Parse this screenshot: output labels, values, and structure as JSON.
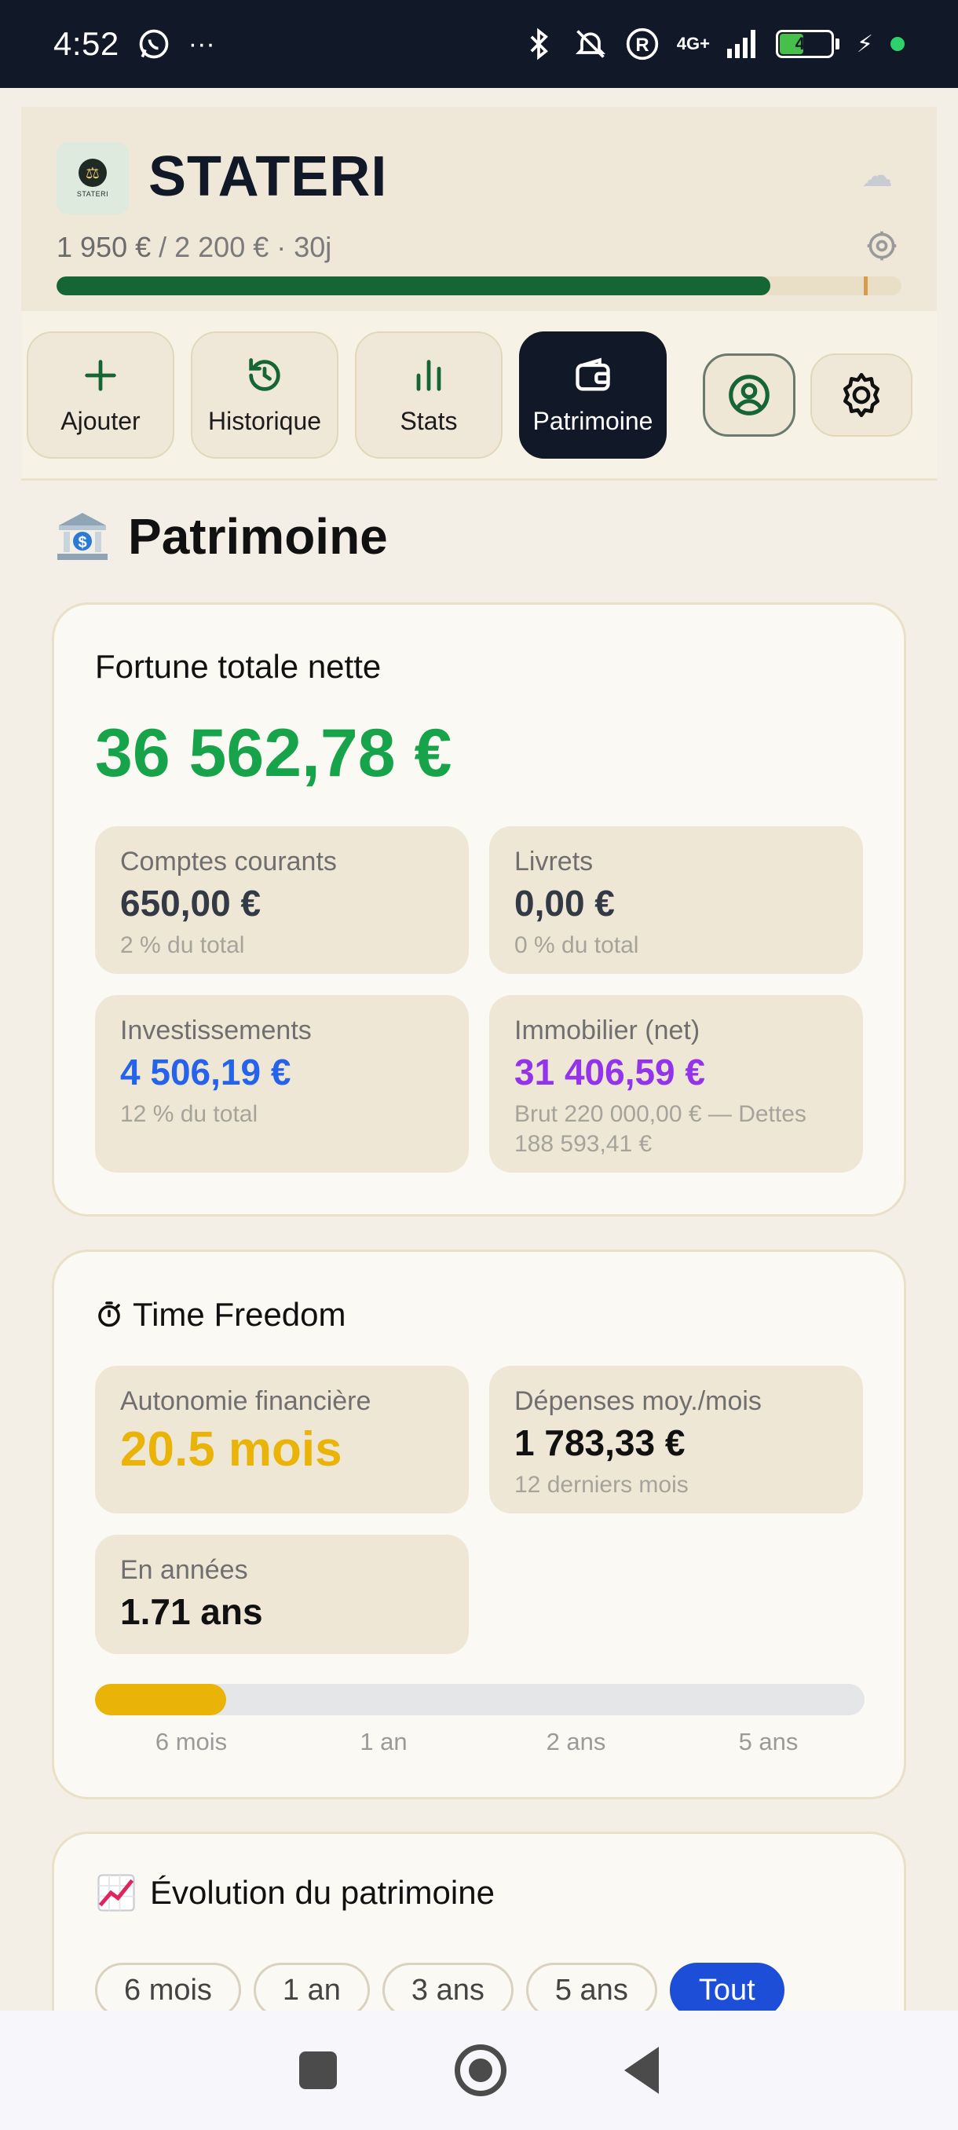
{
  "status_bar": {
    "time": "4:52",
    "network": "4G+",
    "battery_level": "47",
    "battery_fraction": 0.47,
    "more": "···"
  },
  "header": {
    "logo_text": "STATERI",
    "title": "STATERI",
    "budget_spent": "1 950 €",
    "budget_rest": " / 2 200 € · 30j",
    "budget_progress": 0.845,
    "budget_marker": 0.955
  },
  "nav": {
    "add": "Ajouter",
    "history": "Historique",
    "stats": "Stats",
    "wealth": "Patrimoine"
  },
  "page": {
    "title": "Patrimoine"
  },
  "net_worth": {
    "title": "Fortune totale nette",
    "value": "36 562,78 €",
    "tiles": {
      "current": {
        "label": "Comptes courants",
        "value": "650,00 €",
        "sub": "2 % du total"
      },
      "savings": {
        "label": "Livrets",
        "value": "0,00 €",
        "sub": "0 % du total"
      },
      "investments": {
        "label": "Investissements",
        "value": "4 506,19 €",
        "sub": "12 % du total"
      },
      "real_estate": {
        "label": "Immobilier (net)",
        "value": "31 406,59 €",
        "sub": "Brut 220 000,00 € — Dettes 188 593,41 €"
      }
    }
  },
  "time_freedom": {
    "title": "Time Freedom",
    "autonomy": {
      "label": "Autonomie financière",
      "value": "20.5 mois"
    },
    "expenses": {
      "label": "Dépenses moy./mois",
      "value": "1 783,33 €",
      "sub": "12 derniers mois"
    },
    "years": {
      "label": "En années",
      "value": "1.71 ans"
    },
    "progress": 0.17,
    "scale": [
      "6 mois",
      "1 an",
      "2 ans",
      "5 ans"
    ]
  },
  "evolution": {
    "title": "Évolution du patrimoine",
    "periods": [
      "6 mois",
      "1 an",
      "3 ans",
      "5 ans",
      "Tout"
    ],
    "active_period": "Tout"
  },
  "colors": {
    "accent_green": "#16a34a",
    "dark": "#111827",
    "blue": "#1d4ed8",
    "purple": "#9333ea",
    "gold": "#eab308"
  }
}
